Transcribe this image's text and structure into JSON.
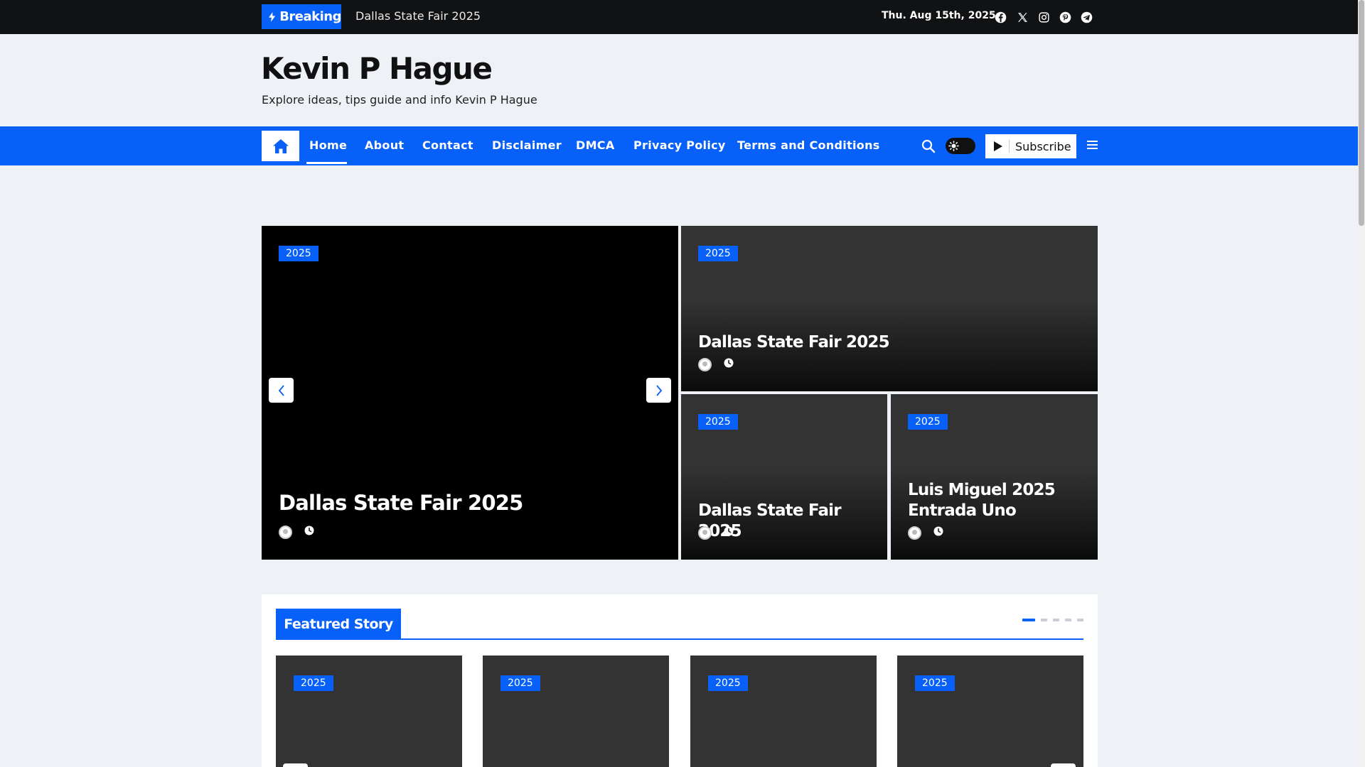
{
  "topbar": {
    "breaking_label": "Breaking",
    "breaking_text": "Dallas State Fair 2025",
    "date": "Thu. Aug 15th, 2025",
    "social_icons": [
      "facebook-icon",
      "x-icon",
      "instagram-icon",
      "pinterest-icon",
      "telegram-icon"
    ]
  },
  "header": {
    "site_title": "Kevin P Hague",
    "tagline": "Explore ideas, tips guide and info Kevin P Hague"
  },
  "nav": {
    "items": [
      "Home",
      "About",
      "Contact",
      "Disclaimer",
      "DMCA",
      "Privacy Policy",
      "Terms and Conditions"
    ],
    "active": "Home",
    "subscribe_label": "Subscribe"
  },
  "hero": {
    "main": {
      "category": "2025",
      "title": "Dallas State Fair 2025"
    },
    "top_right": {
      "category": "2025",
      "title": "Dallas State Fair 2025"
    },
    "bottom_left": {
      "category": "2025",
      "title": "Dallas State Fair 2025"
    },
    "bottom_right": {
      "category": "2025",
      "title_line1": "Luis Miguel 2025",
      "title_line2": "Entrada Uno"
    }
  },
  "featured": {
    "heading": "Featured Story",
    "cards": [
      {
        "category": "2025"
      },
      {
        "category": "2025"
      },
      {
        "category": "2025"
      },
      {
        "category": "2025"
      }
    ],
    "page_dots": 5,
    "active_dot": 1
  },
  "colors": {
    "accent": "#0760f8",
    "topbar_bg": "#111214",
    "page_bg": "#eef1f6"
  }
}
